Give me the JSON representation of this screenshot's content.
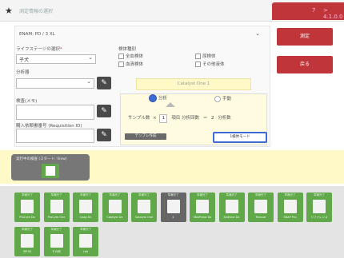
{
  "header": {
    "title": "測定情報の選択",
    "tab_right": [
      "7",
      "> 4.1.0.0"
    ]
  },
  "form": {
    "lifestage_label": "ライフステージの選択",
    "lifestage_required": "*",
    "lifestage_value": "子犬",
    "analyzer_label": "分析器",
    "analyzer_value": "",
    "note_label": "検査(メモ)",
    "request_label": "購入依頼書番号 (Requisition ID)",
    "sample_label": "検体種別",
    "sample_options": [
      "全血検体",
      "血清検体",
      "尿検体",
      "その他液体"
    ],
    "device_label": "Catalyst One 1"
  },
  "calc": {
    "radio_left": "分析",
    "radio_right": "手動",
    "formula_text": "サンプル数",
    "multiply": "×",
    "count": "1",
    "per_label": "項目",
    "result_label": "分析回数",
    "equals": "＝",
    "result": "2",
    "unit": "分析数",
    "left_btn": "テンプレ作成",
    "right_btn": "1検体モード"
  },
  "side_buttons": {
    "run": "測定",
    "back": "戻る"
  },
  "workflow": {
    "caption": "実行中の検査 (スタート: View)"
  },
  "tiles": [
    {
      "cap": "準備完了",
      "name": "ProCyte Dx"
    },
    {
      "cap": "準備完了",
      "name": "ProCyte One"
    },
    {
      "cap": "準備完了",
      "name": "Coag Dx"
    },
    {
      "cap": "準備完了",
      "name": "Catalyst Dx"
    },
    {
      "cap": "準備完了",
      "name": "Catalyst One"
    },
    {
      "cap": "準備完了",
      "name": "2"
    },
    {
      "cap": "準備完了",
      "name": "SNAPshot Dx"
    },
    {
      "cap": "準備完了",
      "name": "SediVue Dx"
    },
    {
      "cap": "準備完了",
      "name": "Manual"
    },
    {
      "cap": "準備完了",
      "name": "SNAP Pro"
    },
    {
      "cap": "準備完了",
      "name": "リファレンス"
    },
    {
      "cap": "準備完了",
      "name": "IDEXX"
    },
    {
      "cap": "準備完了",
      "name": "その他"
    },
    {
      "cap": "準備完了",
      "name": "Lab"
    }
  ]
}
